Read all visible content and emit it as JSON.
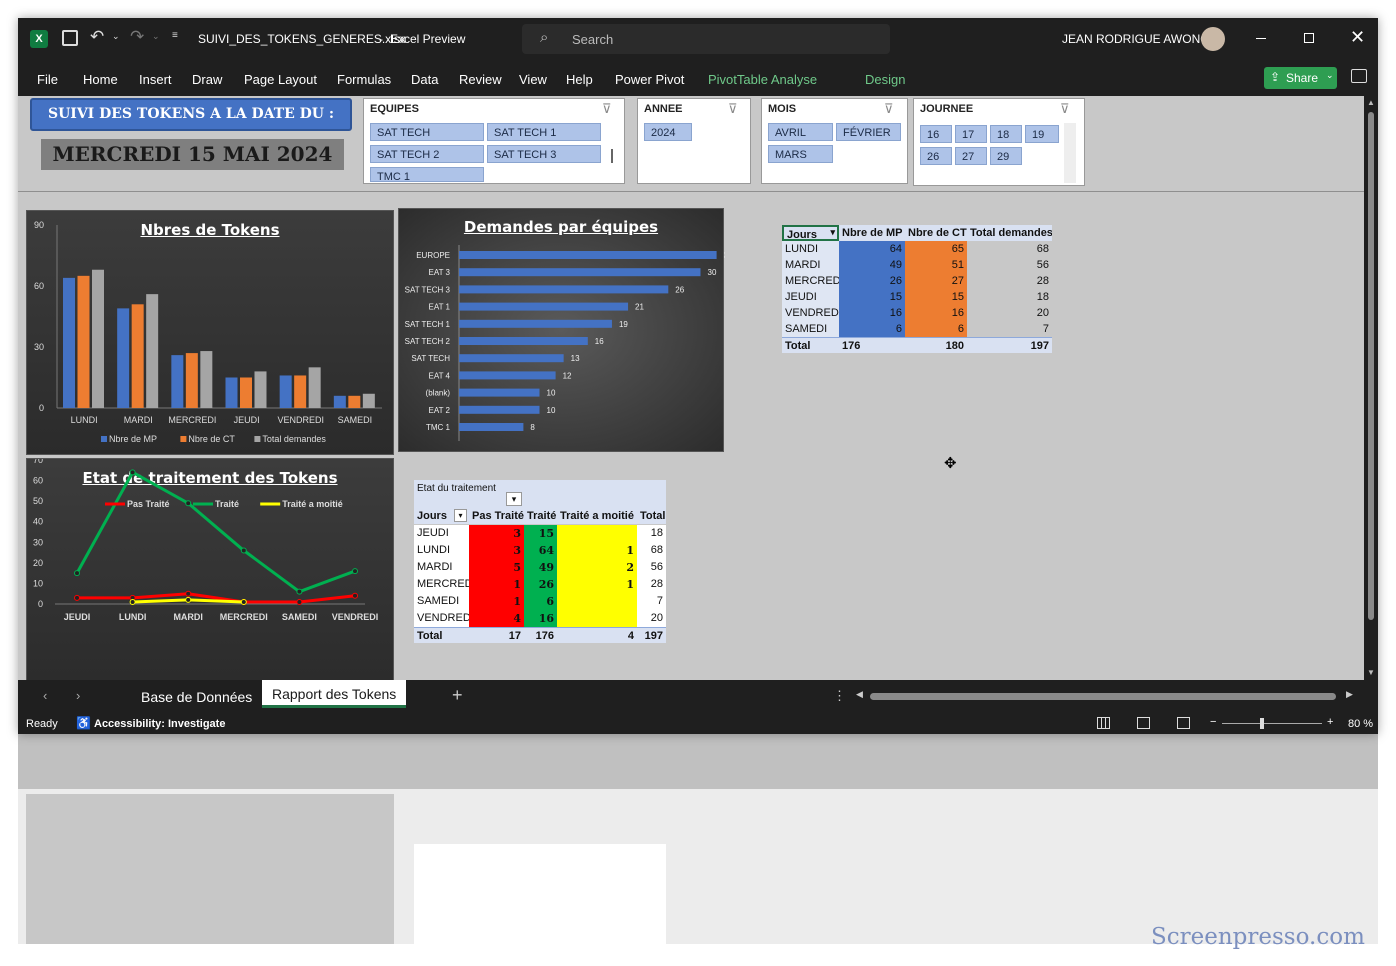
{
  "window": {
    "file_name": "SUIVI_DES_TOKENS_GENERES.xlsx",
    "separator": "-",
    "app_name": "Excel Preview",
    "search_placeholder": "Search",
    "user_name": "JEAN RODRIGUE AWONO"
  },
  "menu": {
    "items": [
      "File",
      "Home",
      "Insert",
      "Draw",
      "Page Layout",
      "Formulas",
      "Data",
      "Review",
      "View",
      "Help",
      "Power Pivot"
    ],
    "context_tabs": [
      "PivotTable Analyse",
      "Design"
    ],
    "share_label": "Share"
  },
  "banner": {
    "heading": "SUIVI DES TOKENS A LA  DATE DU :",
    "date": "MERCREDI 15 MAI 2024"
  },
  "slicers": {
    "equipes": {
      "title": "EQUIPES",
      "items": [
        "SAT TECH",
        "SAT TECH 1",
        "SAT TECH 2",
        "SAT TECH 3",
        "TMC 1"
      ]
    },
    "annee": {
      "title": "ANNEE",
      "items": [
        "2024"
      ]
    },
    "mois": {
      "title": "MOIS",
      "items": [
        "AVRIL",
        "FÉVRIER",
        "MARS"
      ]
    },
    "journee": {
      "title": "JOURNEE",
      "items": [
        "16",
        "17",
        "18",
        "19",
        "26",
        "27",
        "29"
      ]
    }
  },
  "colors": {
    "mp": "#4472c4",
    "ct": "#ed7d31",
    "total": "#a5a5a5",
    "red": "#ff0000",
    "green": "#00b050",
    "yellow": "#ffff00",
    "accent_green": "#2e9e52"
  },
  "chart_data": [
    {
      "type": "bar",
      "title": "Nbres de Tokens",
      "categories": [
        "LUNDI",
        "MARDI",
        "MERCREDI",
        "JEUDI",
        "VENDREDI",
        "SAMEDI"
      ],
      "series": [
        {
          "name": "Nbre de  MP",
          "values": [
            64,
            49,
            26,
            15,
            16,
            6
          ]
        },
        {
          "name": "Nbre de CT",
          "values": [
            65,
            51,
            27,
            15,
            16,
            6
          ]
        },
        {
          "name": "Total demandes",
          "values": [
            68,
            56,
            28,
            18,
            20,
            7
          ]
        }
      ],
      "ylim": [
        0,
        90
      ],
      "yticks": [
        "0",
        "30",
        "60",
        "90"
      ],
      "legend": "bottom"
    },
    {
      "type": "bar",
      "orientation": "horizontal",
      "title": "Demandes par équipes",
      "categories": [
        "EUROPE",
        "EAT 3",
        "SAT TECH 3",
        "EAT 1",
        "SAT TECH 1",
        "SAT TECH 2",
        "SAT TECH",
        "EAT 4",
        "(blank)",
        "EAT 2",
        "TMC 1"
      ],
      "values": [
        32,
        30,
        26,
        21,
        19,
        16,
        13,
        12,
        10,
        10,
        8
      ]
    },
    {
      "type": "line",
      "title": "Etat de traitement des Tokens",
      "categories": [
        "JEUDI",
        "LUNDI",
        "MARDI",
        "MERCREDI",
        "SAMEDI",
        "VENDREDI"
      ],
      "series": [
        {
          "name": "Pas Traité",
          "values": [
            3,
            3,
            5,
            1,
            1,
            4
          ]
        },
        {
          "name": "Traité",
          "values": [
            15,
            64,
            49,
            26,
            6,
            16
          ]
        },
        {
          "name": "Traité a moitié",
          "values": [
            null,
            1,
            2,
            1,
            null,
            null
          ]
        }
      ],
      "ylim": [
        0,
        70
      ],
      "yticks": [
        "0",
        "10",
        "20",
        "30",
        "40",
        "50",
        "60",
        "70"
      ],
      "legend": "top"
    }
  ],
  "pivot1": {
    "headers": [
      "Jours",
      "Nbre de  MP",
      "Nbre de CT",
      "Total demandes"
    ],
    "rows": [
      [
        "LUNDI",
        "64",
        "65",
        "68"
      ],
      [
        "MARDI",
        "49",
        "51",
        "56"
      ],
      [
        "MERCREDI",
        "26",
        "27",
        "28"
      ],
      [
        "JEUDI",
        "15",
        "15",
        "18"
      ],
      [
        "VENDREDI",
        "16",
        "16",
        "20"
      ],
      [
        "SAMEDI",
        "6",
        "6",
        "7"
      ]
    ],
    "total": [
      "Total",
      "176",
      "180",
      "197"
    ]
  },
  "pivot2": {
    "filter_label": "Etat du traitement",
    "headers": [
      "Jours",
      "Pas Traité",
      "Traité",
      "Traité a moitié",
      "Total"
    ],
    "rows": [
      [
        "JEUDI",
        "3",
        "15",
        "",
        "18"
      ],
      [
        "LUNDI",
        "3",
        "64",
        "1",
        "68"
      ],
      [
        "MARDI",
        "5",
        "49",
        "2",
        "56"
      ],
      [
        "MERCREDI",
        "1",
        "26",
        "1",
        "28"
      ],
      [
        "SAMEDI",
        "1",
        "6",
        "",
        "7"
      ],
      [
        "VENDREDI",
        "4",
        "16",
        "",
        "20"
      ]
    ],
    "total": [
      "Total",
      "17",
      "176",
      "4",
      "197"
    ]
  },
  "sheet_tabs": [
    "Base de Données",
    "Rapport des Tokens"
  ],
  "status": {
    "ready": "Ready",
    "accessibility": "Accessibility: Investigate",
    "zoom": "80 %"
  },
  "watermark": "Screenpresso.com"
}
